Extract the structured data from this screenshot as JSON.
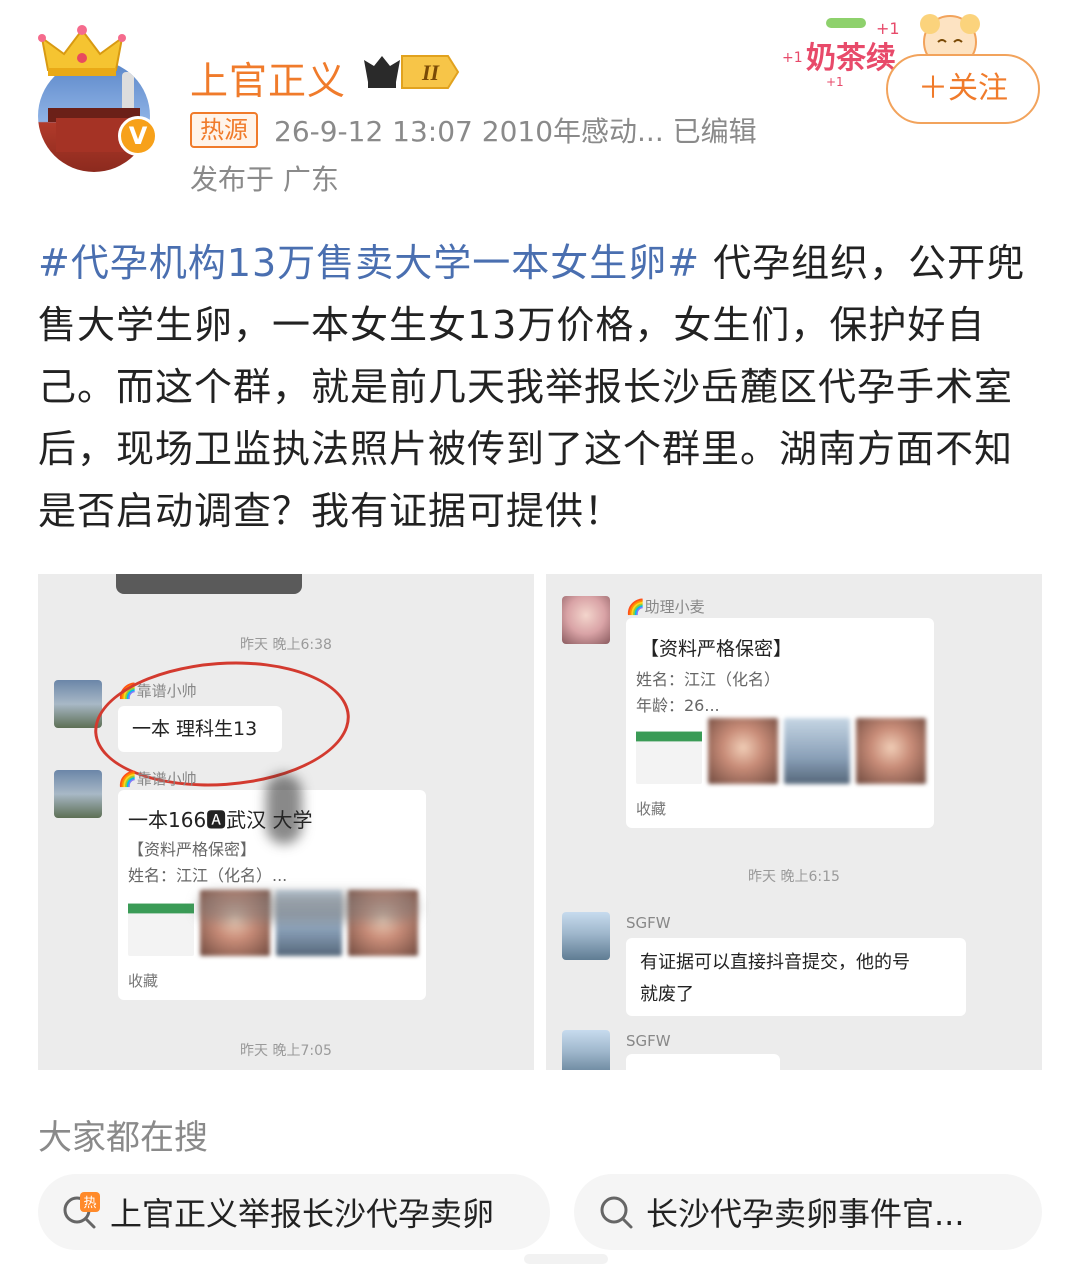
{
  "header": {
    "username": "上官正义",
    "level": "II",
    "source_tag": "热源",
    "meta": "26-9-12 13:07  2010年感动...  已编辑",
    "location": "发布于 广东",
    "sticker_text": "奶茶续",
    "follow_label": "关注",
    "accent_color": "#f07b2b"
  },
  "post": {
    "hashtag": "#代孕机构13万售卖大学一本女生卵#",
    "text": " 代孕组织，公开兜售大学生卵，一本女生女13万价格，女生们，保护好自己。而这个群，就是前几天我举报长沙岳麓区代孕手术室后，现场卫监执法照片被传到了这个群里。湖南方面不知是否启动调查？我有证据可提供！",
    "hashtag_color": "#4a6fb0"
  },
  "images": {
    "left": {
      "top_ts": "昨天 晚上6:38",
      "msg1_sender": "🌈靠谱小帅",
      "msg1_text": "一本 理科生13",
      "msg2_sender": "🌈靠谱小帅",
      "card_title": "一本166🅰武汉       大学",
      "card_line1": "【资料严格保密】",
      "card_line2": "姓名：江江（化名）...",
      "card_fav": "收藏",
      "bottom_ts": "昨天 晚上7:05"
    },
    "right": {
      "sender1": "🌈助理小麦",
      "card_title": "【资料严格保密】",
      "card_line1": "姓名：江江（化名）",
      "card_line2": "年龄：26...",
      "card_fav": "收藏",
      "mid_ts": "昨天 晚上6:15",
      "sender2": "SGFW",
      "msg2_line1": "有证据可以直接抖音提交，他的号",
      "msg2_line2": "就废了",
      "sender3": "SGFW"
    }
  },
  "search": {
    "title": "大家都在搜",
    "items": [
      {
        "label": "上官正义举报长沙代孕卖卵",
        "icon": "hot-search-icon"
      },
      {
        "label": "长沙代孕卖卵事件官...",
        "icon": "search-icon"
      }
    ]
  }
}
